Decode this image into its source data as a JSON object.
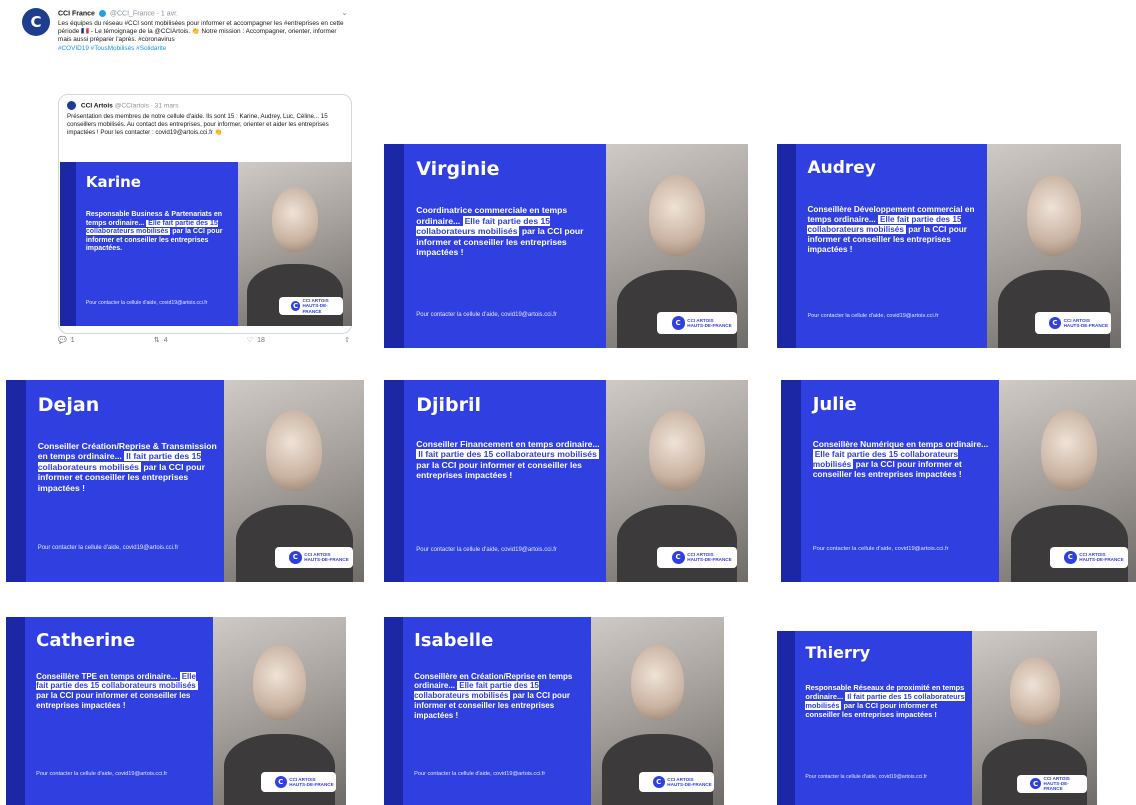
{
  "tweet": {
    "author": "CCI France",
    "meta": "@CCI_France · 1 avr.",
    "text": "Les équipes du réseau #CCI sont mobilisées pour informer et accompagner les #entreprises en cette période 🇫🇷 - Le témoignage de la @CCIArtois. 👏 Notre mission : Accompagner, orienter, informer mais aussi préparer l'après. #coronavirus",
    "link": "#COVID19 #TousMobilisés #Solidarite",
    "quote_author": "CCI Artois",
    "quote_meta": "@CCIartois · 31 mars",
    "quote_text": "Présentation des membres de notre cellule d'aide. Ils sont 15 : Karine, Audrey, Luc, Céline... 15 conseillers mobilisés. Au contact des entreprises, pour informer, orienter et aider les entreprises impactées ! Pour les contacter : covid19@artois.cci.fr 👏",
    "actions": {
      "reply": "1",
      "retweet": "4",
      "like": "18",
      "share": ""
    }
  },
  "cards": [
    {
      "name": "Karine",
      "role": "Responsable Business & Partenariats en temps ordinaire...",
      "highlight": "Elle fait partie des 15 collaborateurs mobilisés",
      "rest": " par la CCI pour informer et conseiller les entreprises impactées.",
      "contact": "Pour contacter la cellule d'aide, covid19@artois.cci.fr"
    },
    {
      "name": "Virginie",
      "role": "Coordinatrice commerciale en temps ordinaire...",
      "highlight": "Elle fait partie des 15 collaborateurs mobilisés",
      "rest": " par la CCI pour informer et conseiller les entreprises impactées !",
      "contact": "Pour contacter la cellule d'aide, covid19@artois.cci.fr"
    },
    {
      "name": "Audrey",
      "role": "Conseillère Développement commercial en temps ordinaire...",
      "highlight": "Elle fait partie des 15 collaborateurs mobilisés",
      "rest": " par la CCI pour informer et conseiller les entreprises impactées !",
      "contact": "Pour contacter la cellule d'aide, covid19@artois.cci.fr"
    },
    {
      "name": "Dejan",
      "role": "Conseiller Création/Reprise & Transmission en temps ordinaire...",
      "highlight": "Il fait partie des 15 collaborateurs mobilisés",
      "rest": " par la CCI pour informer et conseiller les entreprises impactées !",
      "contact": "Pour contacter la cellule d'aide, covid19@artois.cci.fr"
    },
    {
      "name": "Djibril",
      "role": "Conseiller Financement en temps ordinaire...",
      "highlight": "Il fait partie des 15 collaborateurs mobilisés",
      "rest": " par la CCI pour informer et conseiller les entreprises impactées !",
      "contact": "Pour contacter la cellule d'aide, covid19@artois.cci.fr"
    },
    {
      "name": "Julie",
      "role": "Conseillère Numérique en temps ordinaire...",
      "highlight": "Elle fait partie des 15 collaborateurs mobilisés",
      "rest": " par la CCI pour informer et conseiller les entreprises impactées !",
      "contact": "Pour contacter la cellule d'aide, covid19@artois.cci.fr"
    },
    {
      "name": "Catherine",
      "role": "Conseillère TPE en temps ordinaire...",
      "highlight": "Elle fait partie des 15 collaborateurs mobilisés",
      "rest": " par la CCI pour informer et conseiller les entreprises impactées !",
      "contact": "Pour contacter la cellule d'aide, covid19@artois.cci.fr"
    },
    {
      "name": "Isabelle",
      "role": "Conseillère en Création/Reprise en temps ordinaire...",
      "highlight": "Elle fait partie des 15 collaborateurs mobilisés",
      "rest": " par la CCI pour informer et conseiller les entreprises impactées !",
      "contact": "Pour contacter la cellule d'aide, covid19@artois.cci.fr"
    },
    {
      "name": "Thierry",
      "role": "Responsable Réseaux de proximité en temps ordinaire...",
      "highlight": "Il fait partie des 15 collaborateurs mobilisés",
      "rest": " par la CCI pour informer et conseiller les entreprises impactées !",
      "contact": "Pour contacter la cellule d'aide, covid19@artois.cci.fr"
    }
  ],
  "logo": {
    "line1": "CCI ARTOIS",
    "line2": "HAUTS-DE-FRANCE",
    "mark": "C"
  },
  "colors": {
    "card_blue": "#2f3fe0",
    "stripe": "#1c27a6",
    "link": "#1b95e0"
  },
  "icons": [
    "reply-icon",
    "retweet-icon",
    "like-icon",
    "share-icon",
    "verified-icon"
  ]
}
